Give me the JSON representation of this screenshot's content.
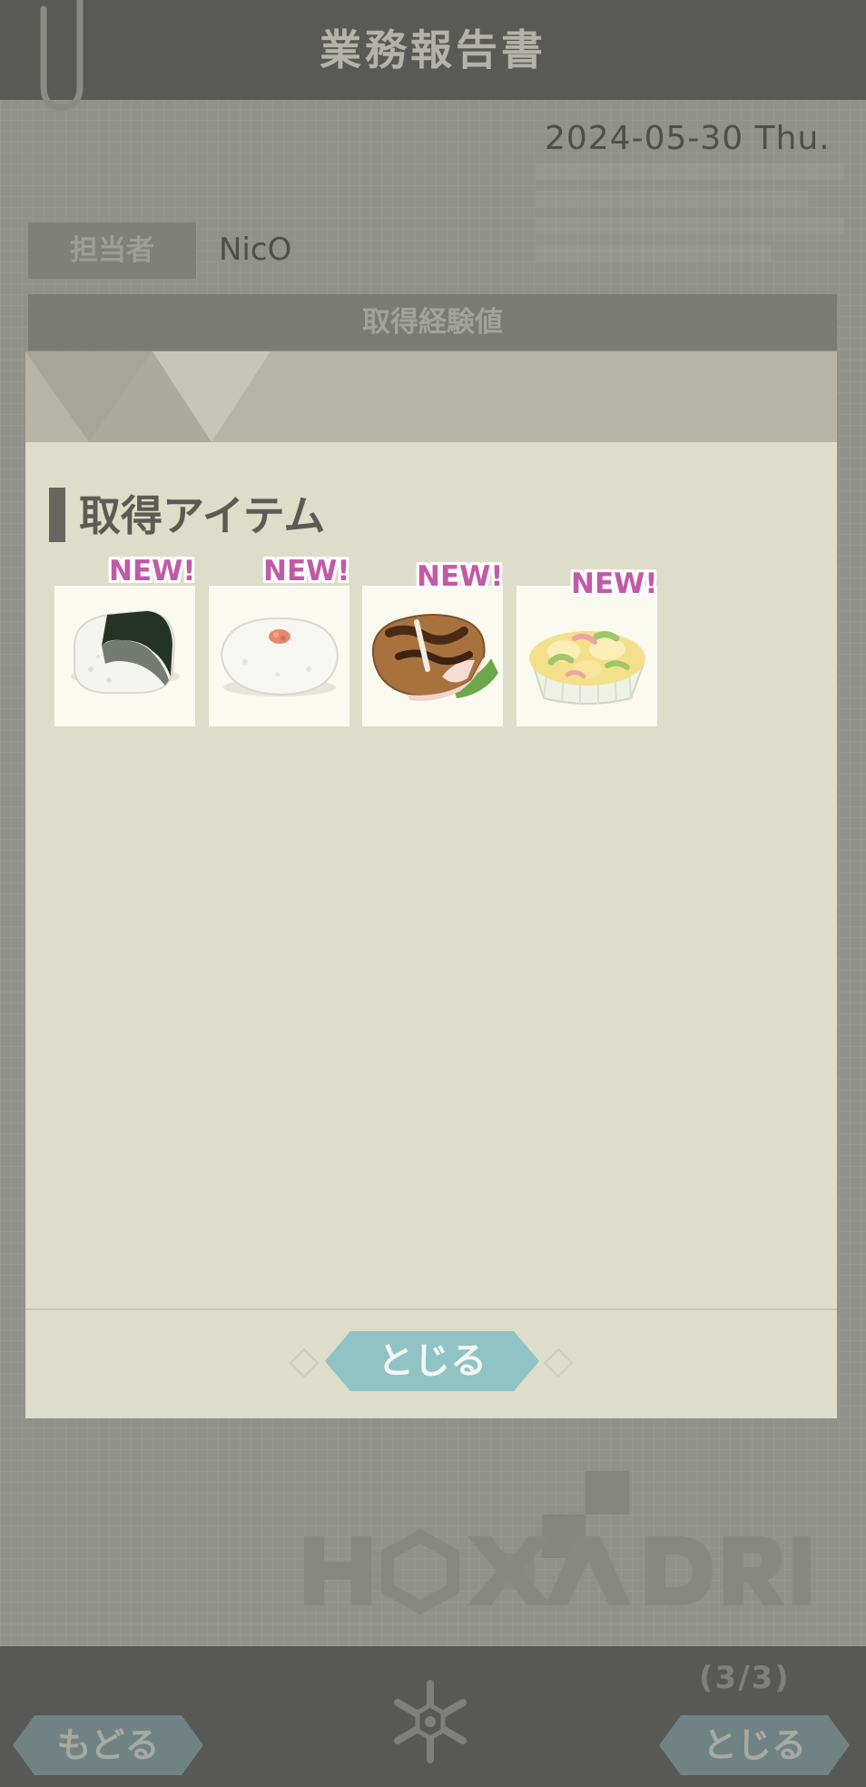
{
  "header": {
    "title": "業務報告書"
  },
  "report": {
    "date": "2024-05-30 Thu.",
    "assignee_label": "担当者",
    "assignee_name": "NicO",
    "exp_label": "取得経験値"
  },
  "items_section": {
    "title": "取得アイテム",
    "items": [
      {
        "name": "nori-onigiri",
        "badge": "NEW!"
      },
      {
        "name": "salmon-onigiri",
        "badge": "NEW!"
      },
      {
        "name": "tonkatsu",
        "badge": "NEW!"
      },
      {
        "name": "potato-salad",
        "badge": "NEW!"
      }
    ],
    "close_button": "とじる"
  },
  "footer": {
    "page_indicator": "(3/3)",
    "back_button": "もどる",
    "close_button": "とじる"
  },
  "watermark": {
    "logo_text": "HEXA DRIVE"
  },
  "colors": {
    "accent": "#8fc3c6",
    "header_bg": "#595955",
    "panel_bg": "#deddc9",
    "badge": "#c25aa6"
  }
}
